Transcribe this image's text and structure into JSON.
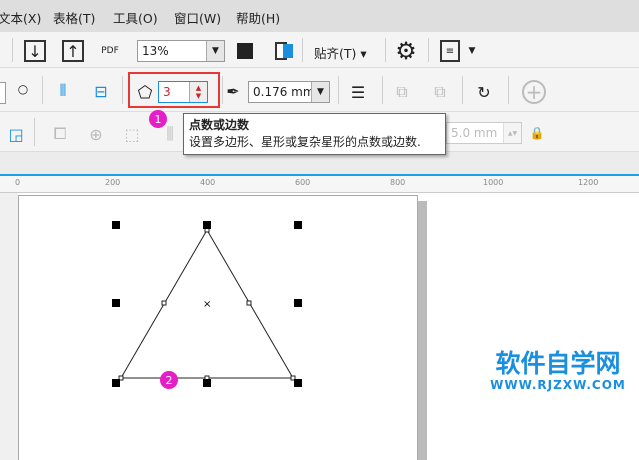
{
  "menu": [
    "文本(X)",
    "表格(T)",
    "工具(O)",
    "窗口(W)",
    "帮助(H)"
  ],
  "toolbar1": {
    "zoom": "13%",
    "snap": "贴齐(T)",
    "pdf": "PDF"
  },
  "toolbar2": {
    "points": "3",
    "outline_width": "0.176 mm"
  },
  "toolbar3": {
    "size": "5.0 mm"
  },
  "tooltip": {
    "title": "点数或边数",
    "body": "设置多边形、星形或复杂星形的点数或边数."
  },
  "badges": [
    "1",
    "2"
  ],
  "ruler": [
    "0",
    "200",
    "400",
    "600",
    "800",
    "1000",
    "1200"
  ],
  "watermark": {
    "title": "软件自学网",
    "url": "WWW.RJZXW.COM",
    "color": "#1a8fe0"
  },
  "colors": {
    "highlight": "#e53935",
    "badge": "#e61ec8",
    "accent": "#1aa0e8"
  }
}
